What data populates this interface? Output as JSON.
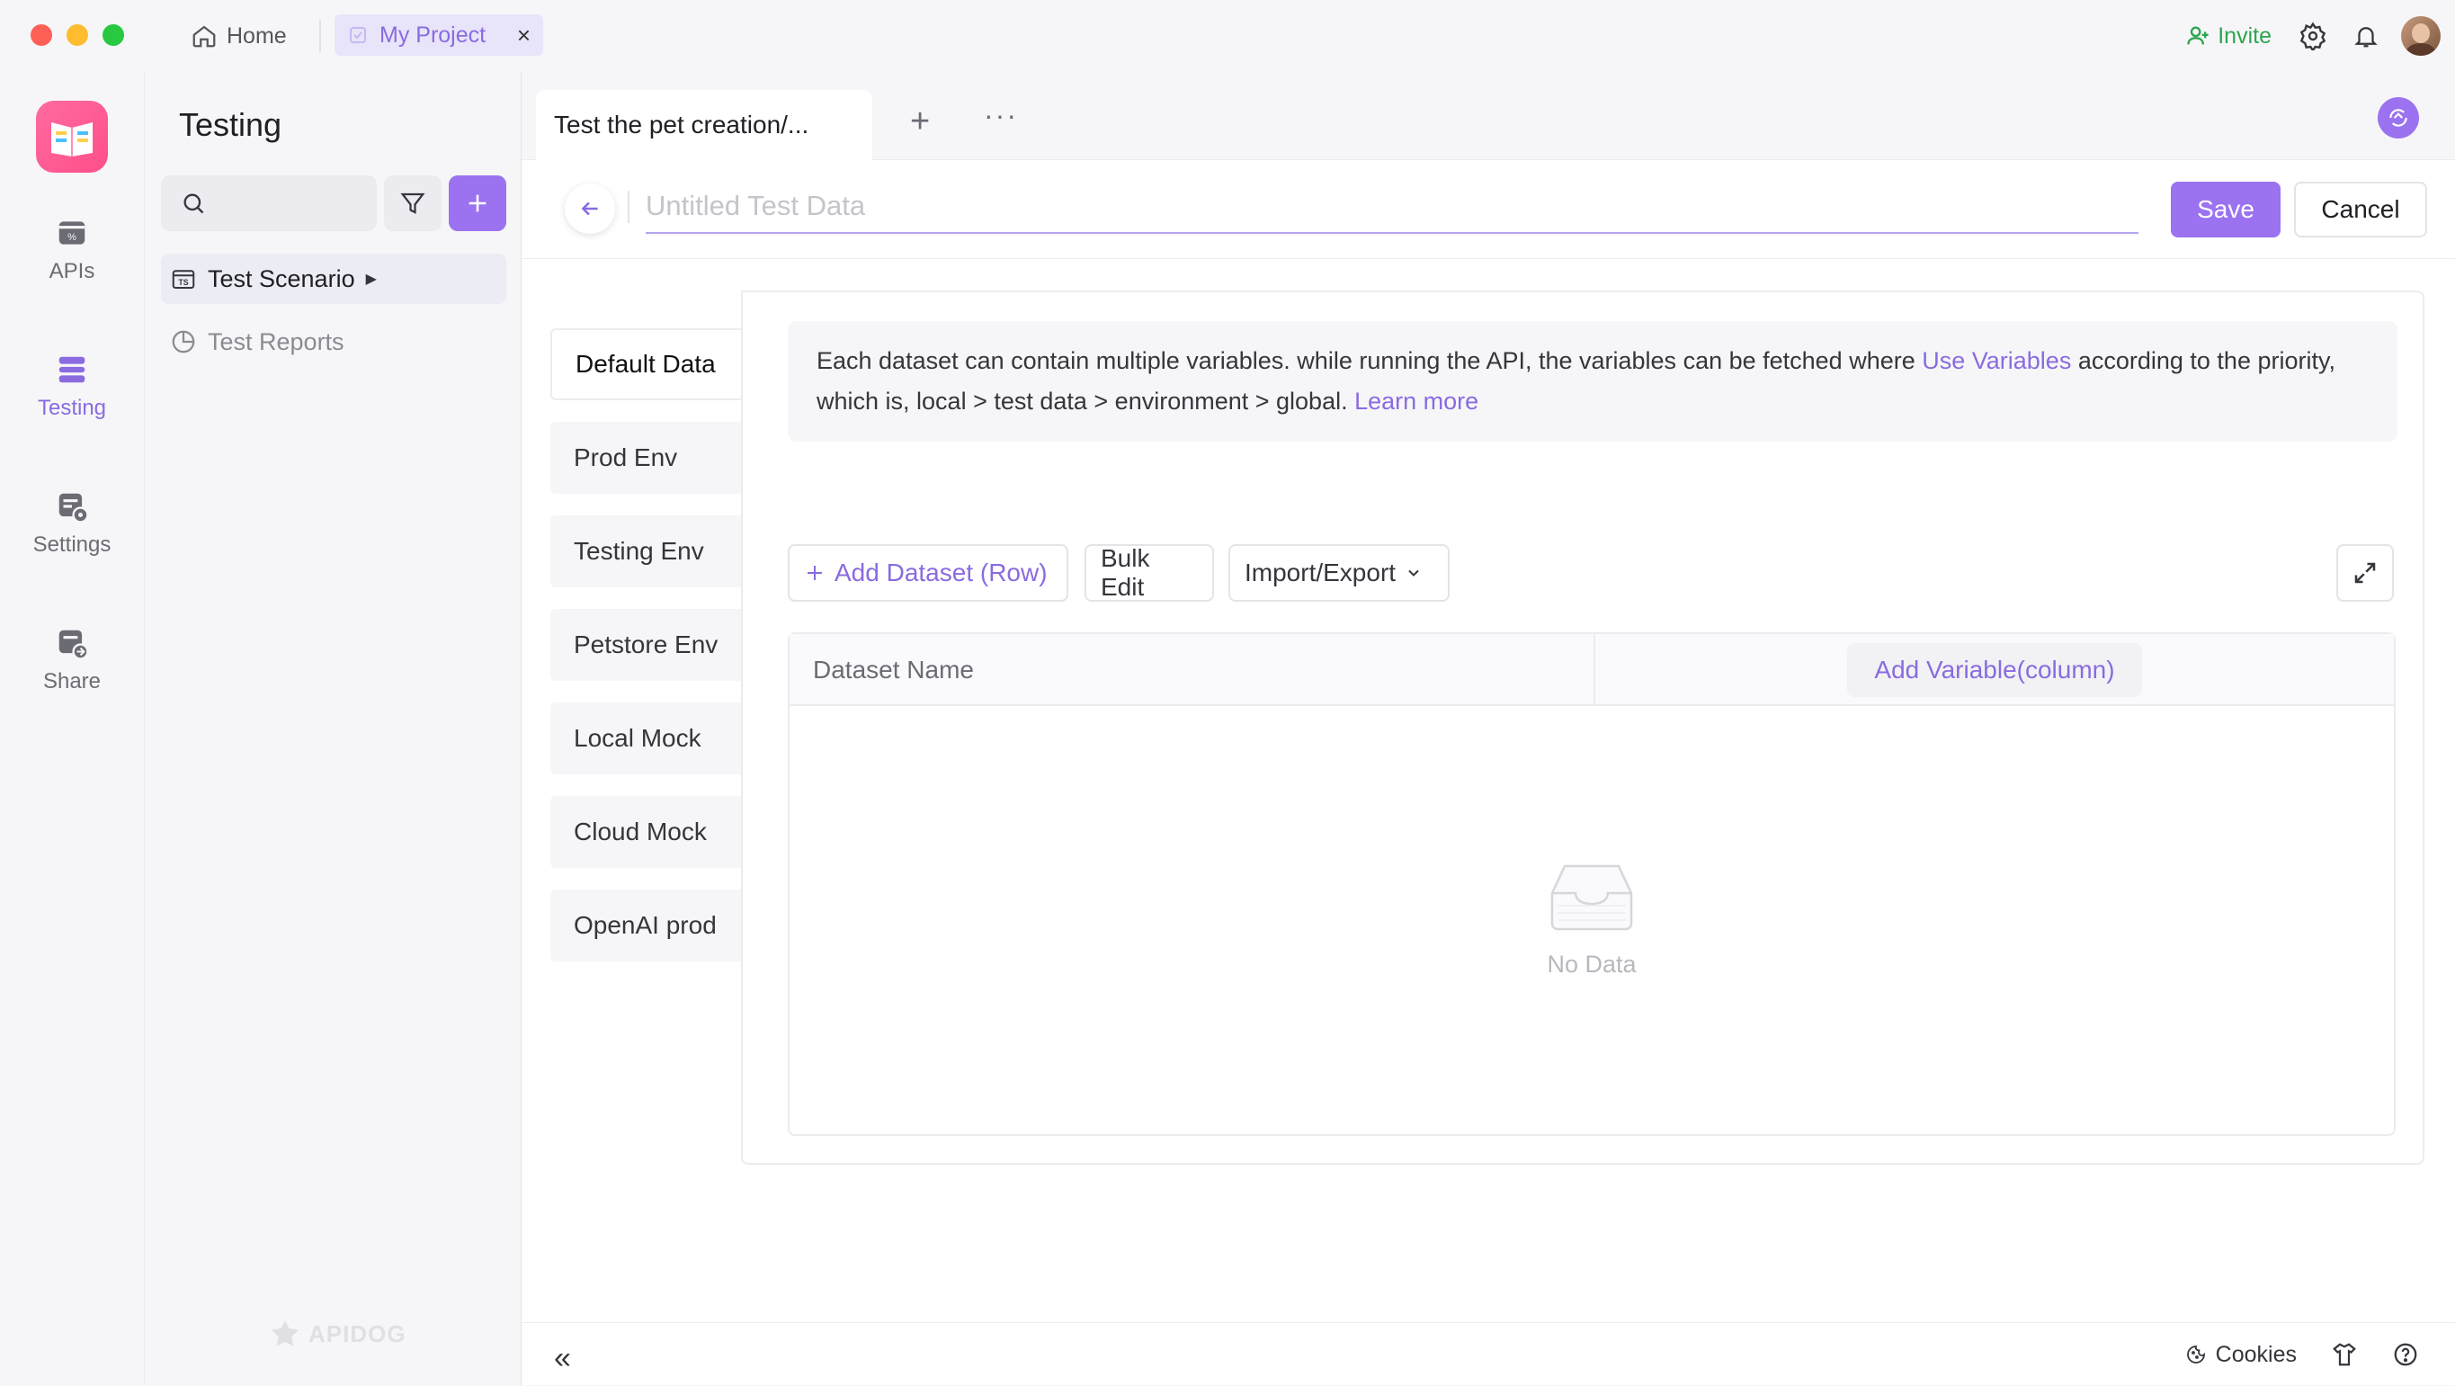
{
  "titlebar": {
    "home_label": "Home",
    "project_tab_label": "My Project",
    "invite_label": "Invite"
  },
  "rail": {
    "items": [
      {
        "label": "APIs",
        "icon": "apis-icon"
      },
      {
        "label": "Testing",
        "icon": "testing-icon",
        "active": true
      },
      {
        "label": "Settings",
        "icon": "settings-icon"
      },
      {
        "label": "Share",
        "icon": "share-icon"
      }
    ]
  },
  "sidebar": {
    "title": "Testing",
    "search_placeholder": "",
    "tree": [
      {
        "label": "Test Scenario",
        "active": true
      },
      {
        "label": "Test Reports"
      }
    ],
    "watermark": "APIDOG"
  },
  "main": {
    "doc_tab_label": "Test the pet creation/...",
    "title_placeholder": "Untitled Test Data",
    "save_label": "Save",
    "cancel_label": "Cancel",
    "environments": [
      {
        "label": "Default Data",
        "active": true
      },
      {
        "label": "Prod Env"
      },
      {
        "label": "Testing Env"
      },
      {
        "label": "Petstore Env"
      },
      {
        "label": "Local Mock"
      },
      {
        "label": "Cloud Mock"
      },
      {
        "label": "OpenAI prod"
      }
    ],
    "info": {
      "text_before": "Each dataset can contain multiple variables. while running the API, the variables can be fetched where ",
      "use_variables_link": "Use Variables",
      "text_middle": " according to the priority, which is, local > test data > environment > global. ",
      "learn_more_link": "Learn more"
    },
    "actions": {
      "add_dataset": "Add Dataset (Row)",
      "bulk_edit": "Bulk Edit",
      "import_export": "Import/Export"
    },
    "table": {
      "col_dataset_name": "Dataset Name",
      "add_variable": "Add Variable(column)",
      "empty_text": "No Data"
    }
  },
  "footer": {
    "cookies_label": "Cookies"
  },
  "colors": {
    "accent": "#9b72f0",
    "invite_green": "#2ea44f",
    "logo_pink": "#ff5a93"
  }
}
